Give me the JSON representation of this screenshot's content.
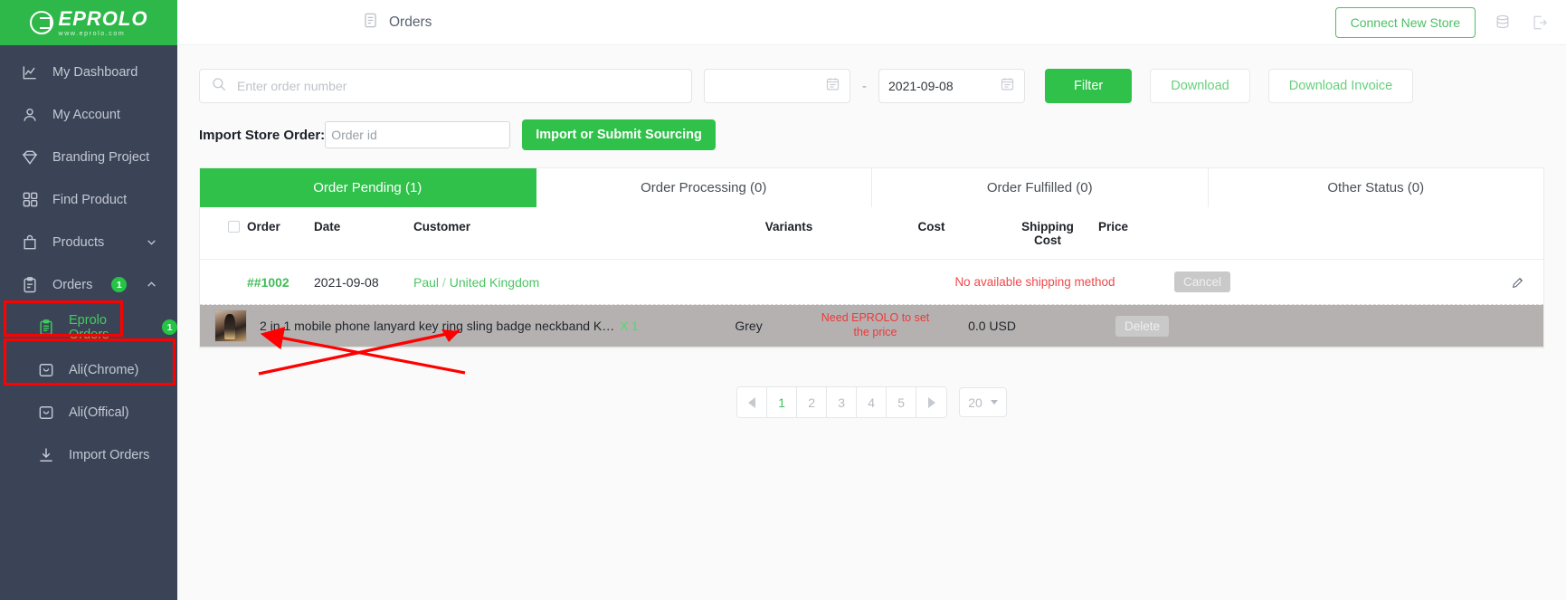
{
  "brand": {
    "logo_name": "EPROLO",
    "logo_url": "www.eprolo.com",
    "green": "#2fc14a",
    "sidebar_bg": "#3b4457",
    "highlight": "#ff0000"
  },
  "sidebar": {
    "items": [
      {
        "label": "My Dashboard",
        "icon": "chart-line-icon",
        "badge": "",
        "expander": ""
      },
      {
        "label": "My Account",
        "icon": "user-icon",
        "badge": "",
        "expander": ""
      },
      {
        "label": "Branding Project",
        "icon": "diamond-icon",
        "badge": "",
        "expander": ""
      },
      {
        "label": "Find Product",
        "icon": "grid-icon",
        "badge": "",
        "expander": ""
      },
      {
        "label": "Products",
        "icon": "bag-icon",
        "badge": "",
        "expander": "chevron-down-icon"
      },
      {
        "label": "Orders",
        "icon": "clipboard-icon",
        "badge": "1",
        "expander": "chevron-up-icon"
      },
      {
        "label": "Eprolo Orders",
        "icon": "clipboard-list-icon",
        "badge": "1",
        "expander": ""
      },
      {
        "label": "Ali(Chrome)",
        "icon": "bag-smile-icon",
        "badge": "",
        "expander": ""
      },
      {
        "label": "Ali(Offical)",
        "icon": "bag-smile-icon",
        "badge": "",
        "expander": ""
      },
      {
        "label": "Import Orders",
        "icon": "download-icon",
        "badge": "",
        "expander": ""
      }
    ]
  },
  "topbar": {
    "page_icon": "document-list-icon",
    "title": "Orders",
    "connect_store_label": "Connect New Store",
    "icons": [
      "server-stack-icon",
      "logout-icon"
    ]
  },
  "filters": {
    "search_icon": "search-icon",
    "search_placeholder": "Enter order number",
    "search_value": "",
    "date_from_value": "",
    "date_from_placeholder": "",
    "date_to_value": "2021-09-08",
    "date_separator": "-",
    "calendar_icon": "calendar-icon",
    "filter_label": "Filter",
    "download_label": "Download",
    "download_invoice_label": "Download Invoice"
  },
  "import": {
    "label": "Import Store Order:",
    "input_placeholder": "Order id",
    "input_value": "",
    "button_label": "Import or Submit Sourcing"
  },
  "tabs": [
    {
      "label": "Order Pending (1)",
      "active": true
    },
    {
      "label": "Order Processing (0)",
      "active": false
    },
    {
      "label": "Order Fulfilled (0)",
      "active": false
    },
    {
      "label": "Other Status (0)",
      "active": false
    }
  ],
  "table": {
    "headers": {
      "order": "Order",
      "date": "Date",
      "customer": "Customer",
      "variants": "Variants",
      "cost": "Cost",
      "shipping_cost_line1": "Shipping",
      "shipping_cost_line2": "Cost",
      "price": "Price"
    },
    "order_row": {
      "order_number": "##1002",
      "date": "2021-09-08",
      "customer_name": "Paul",
      "customer_separator": "/",
      "customer_country": "United Kingdom",
      "shipping_message": "No available shipping method",
      "cancel_label": "Cancel",
      "edit_icon": "pencil-icon"
    },
    "item_row": {
      "thumbnail": "product-thumbnail",
      "title": "2 in 1 mobile phone lanyard key ring sling badge neckband K…",
      "quantity": "X 1",
      "variant": "Grey",
      "price_note": "Need EPROLO to set the price",
      "cost": "0.0 USD",
      "delete_label": "Delete"
    }
  },
  "pagination": {
    "prev_icon": "arrow-left-icon",
    "next_icon": "arrow-right-icon",
    "pages": [
      "1",
      "2",
      "3",
      "4",
      "5"
    ],
    "current_page": "1",
    "per_page": "20"
  }
}
